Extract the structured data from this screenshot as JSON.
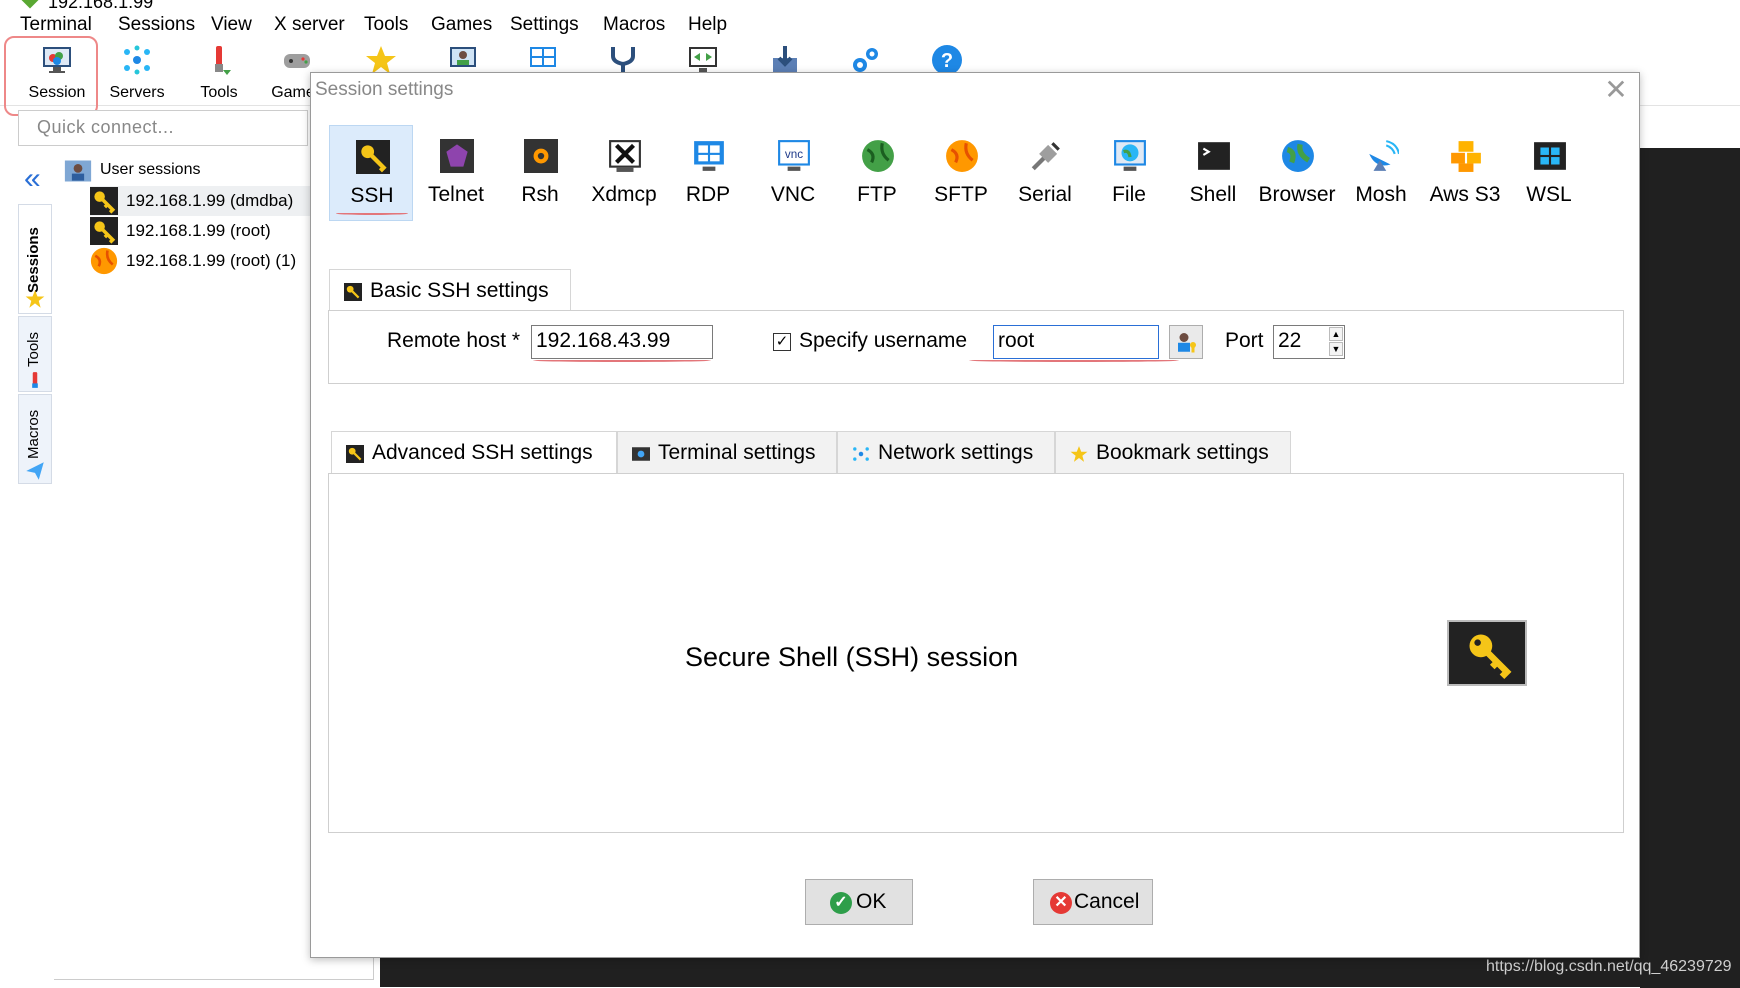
{
  "window": {
    "title": "192.168.1.99"
  },
  "menu": [
    "Terminal",
    "Sessions",
    "View",
    "X server",
    "Tools",
    "Games",
    "Settings",
    "Macros",
    "Help"
  ],
  "toolbar": {
    "session": "Session",
    "servers": "Servers",
    "tools": "Tools",
    "games": "Games"
  },
  "quick_connect": {
    "placeholder": "Quick connect..."
  },
  "side_tabs": {
    "sessions": "Sessions",
    "tools": "Tools",
    "macros": "Macros"
  },
  "tree": {
    "root": "User sessions",
    "items": [
      "192.168.1.99 (dmdba)",
      "192.168.1.99 (root)",
      "192.168.1.99 (root) (1)"
    ]
  },
  "dialog": {
    "title": "Session settings",
    "protocols": [
      "SSH",
      "Telnet",
      "Rsh",
      "Xdmcp",
      "RDP",
      "VNC",
      "FTP",
      "SFTP",
      "Serial",
      "File",
      "Shell",
      "Browser",
      "Mosh",
      "Aws S3",
      "WSL"
    ],
    "selected_protocol": "SSH",
    "basic_tab": "Basic SSH settings",
    "remote_host_label": "Remote host *",
    "remote_host": "192.168.43.99",
    "specify_username_label": "Specify username",
    "specify_username_checked": true,
    "username": "root",
    "port_label": "Port",
    "port": "22",
    "lower_tabs": [
      "Advanced SSH settings",
      "Terminal settings",
      "Network settings",
      "Bookmark settings"
    ],
    "description": "Secure Shell (SSH) session",
    "ok": "OK",
    "cancel": "Cancel"
  },
  "watermark": "https://blog.csdn.net/qq_46239729",
  "colors": {
    "accent": "#2a6fd6",
    "selection": "#dcebfb",
    "annotation": "#e3767a",
    "terminal": "#202020"
  }
}
